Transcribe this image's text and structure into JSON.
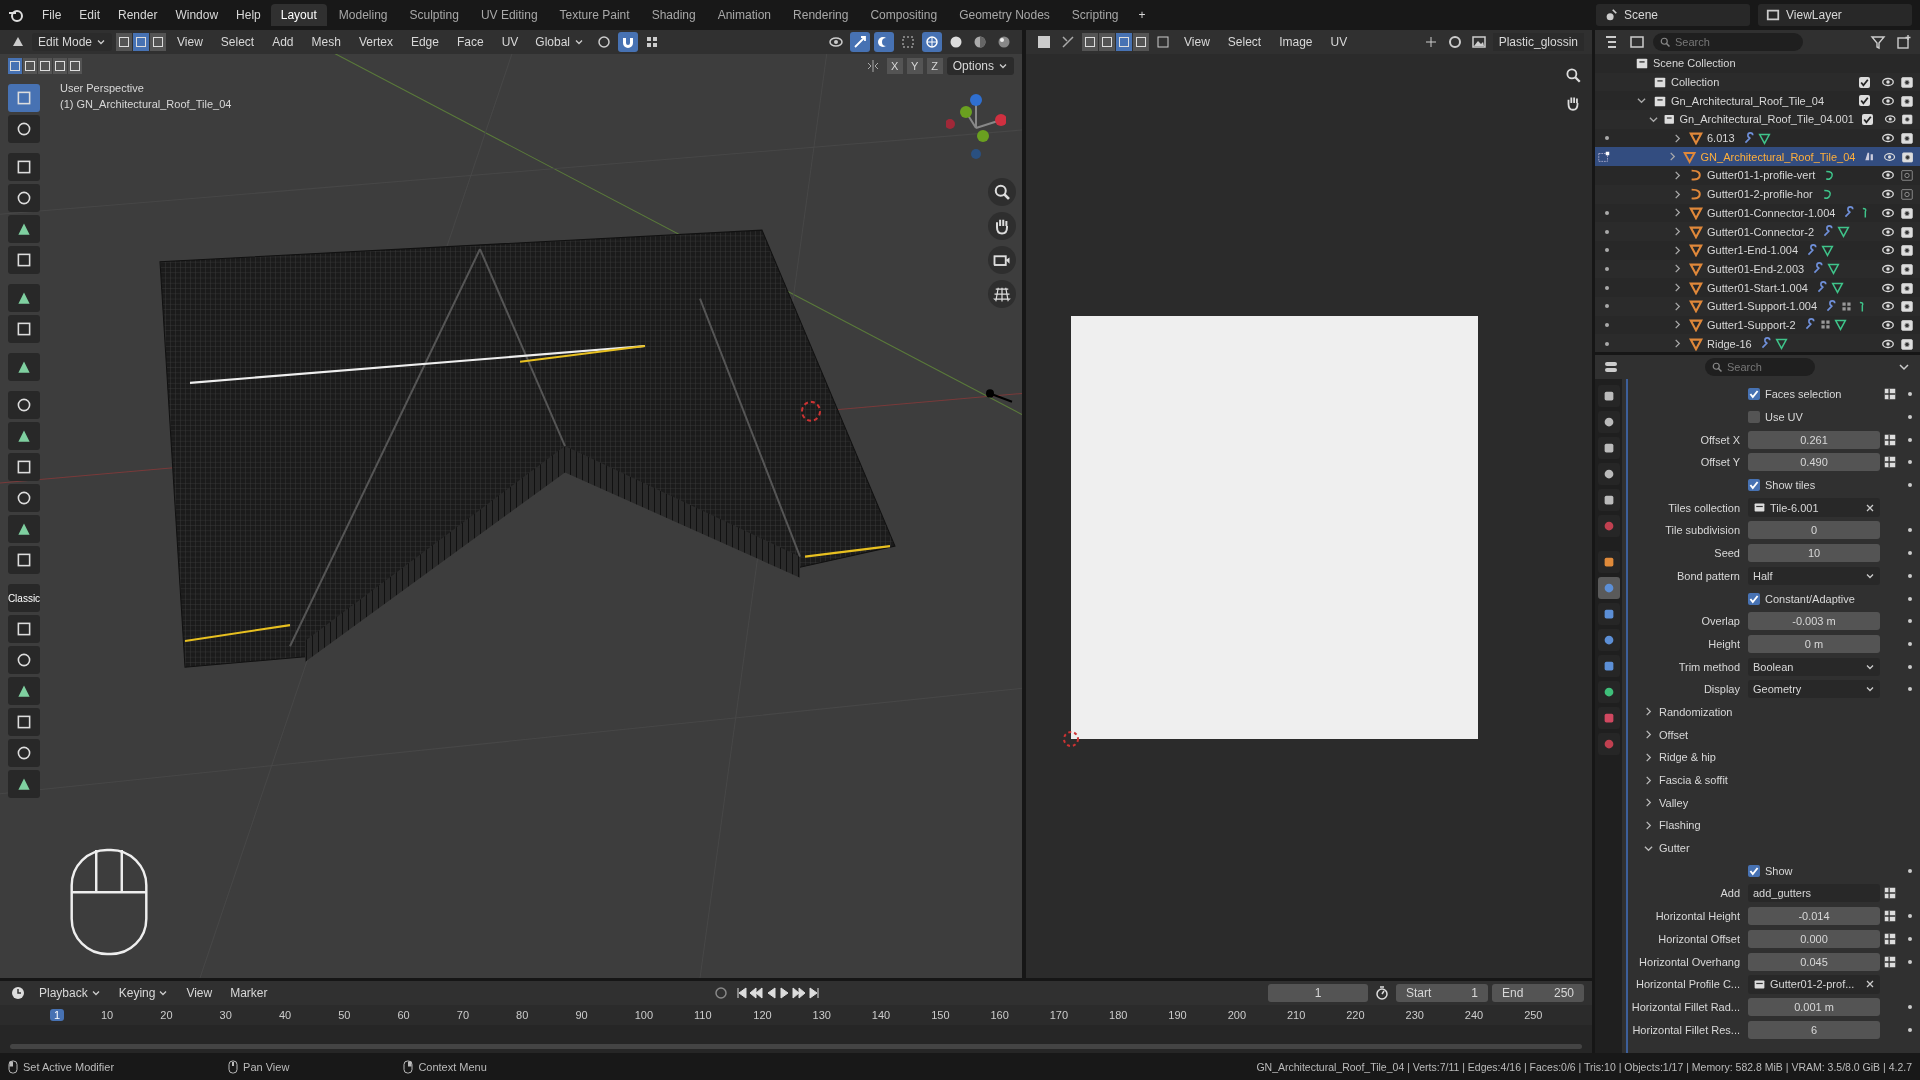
{
  "topbar": {
    "menus": [
      "File",
      "Edit",
      "Render",
      "Window",
      "Help"
    ],
    "workspaces": [
      {
        "label": "Layout",
        "selected": true
      },
      {
        "label": "Modeling",
        "selected": false
      },
      {
        "label": "Sculpting",
        "selected": false
      },
      {
        "label": "UV Editing",
        "selected": false
      },
      {
        "label": "Texture Paint",
        "selected": false
      },
      {
        "label": "Shading",
        "selected": false
      },
      {
        "label": "Animation",
        "selected": false
      },
      {
        "label": "Rendering",
        "selected": false
      },
      {
        "label": "Compositing",
        "selected": false
      },
      {
        "label": "Geometry Nodes",
        "selected": false
      },
      {
        "label": "Scripting",
        "selected": false
      }
    ],
    "add_tab": "+",
    "scene": "Scene",
    "view_layer": "ViewLayer"
  },
  "viewport": {
    "mode": "Edit Mode",
    "menus": [
      "View",
      "Select",
      "Add",
      "Mesh",
      "Vertex",
      "Edge",
      "Face",
      "UV"
    ],
    "orientation": "Global",
    "select_modes": [
      {
        "selected": false
      },
      {
        "selected": true
      },
      {
        "selected": false
      }
    ],
    "axes": [
      "X",
      "Y",
      "Z"
    ],
    "options": "Options",
    "perspective": "User Perspective",
    "object": "(1) GN_Architectural_Roof_Tile_04",
    "tool_label": "Classic"
  },
  "image_editor": {
    "menus": [
      "View",
      "Select",
      "Image",
      "UV"
    ],
    "image": "Plastic_glossin"
  },
  "outliner": {
    "search": {
      "placeholder": "Search"
    },
    "items": [
      {
        "name": "Scene Collection",
        "kind": "scene_collection",
        "children": [
          {
            "name": "Collection",
            "kind": "collection",
            "checked": true
          },
          {
            "name": "Gn_Architectural_Roof_Tile_04",
            "kind": "collection",
            "checked": true,
            "expanded": true,
            "children": [
              {
                "name": "Gn_Architectural_Roof_Tile_04.001",
                "kind": "collection",
                "checked": true,
                "expanded": true,
                "children": [
                  {
                    "name": "6.013",
                    "kind": "mesh",
                    "expanded": false,
                    "selected": false,
                    "edit_mode": false,
                    "renderable": true,
                    "extras": [
                      {
                        "kind": "wrench"
                      },
                      {
                        "kind": "mesh"
                      }
                    ]
                  },
                  {
                    "name": "GN_Architectural_Roof_Tile_04",
                    "kind": "mesh",
                    "expanded": false,
                    "selected": true,
                    "edit_mode": true,
                    "renderable": true,
                    "extras": [
                      {
                        "kind": "nodes"
                      }
                    ]
                  },
                  {
                    "name": "Gutter01-1-profile-vert",
                    "kind": "curve",
                    "expanded": false,
                    "selected": false,
                    "renderable": false,
                    "extras": [
                      {
                        "kind": "curve"
                      }
                    ]
                  },
                  {
                    "name": "Gutter01-2-profile-hor",
                    "kind": "curve",
                    "expanded": false,
                    "selected": false,
                    "renderable": false,
                    "extras": [
                      {
                        "kind": "curve"
                      }
                    ]
                  },
                  {
                    "name": "Gutter01-Connector-1.004",
                    "kind": "mesh",
                    "expanded": false,
                    "selected": false,
                    "edit_mode": false,
                    "renderable": true,
                    "extras": [
                      {
                        "kind": "wrench"
                      },
                      {
                        "kind": "hook"
                      }
                    ]
                  },
                  {
                    "name": "Gutter01-Connector-2",
                    "kind": "mesh",
                    "expanded": false,
                    "selected": false,
                    "edit_mode": false,
                    "renderable": true,
                    "extras": [
                      {
                        "kind": "wrench"
                      },
                      {
                        "kind": "mesh"
                      }
                    ]
                  },
                  {
                    "name": "Gutter1-End-1.004",
                    "kind": "mesh",
                    "expanded": false,
                    "selected": false,
                    "edit_mode": false,
                    "renderable": true,
                    "extras": [
                      {
                        "kind": "wrench"
                      },
                      {
                        "kind": "mesh"
                      }
                    ]
                  },
                  {
                    "name": "Gutter01-End-2.003",
                    "kind": "mesh",
                    "expanded": false,
                    "selected": false,
                    "edit_mode": false,
                    "renderable": true,
                    "extras": [
                      {
                        "kind": "wrench"
                      },
                      {
                        "kind": "mesh"
                      }
                    ]
                  },
                  {
                    "name": "Gutter01-Start-1.004",
                    "kind": "mesh",
                    "expanded": false,
                    "selected": false,
                    "edit_mode": false,
                    "renderable": true,
                    "extras": [
                      {
                        "kind": "wrench"
                      },
                      {
                        "kind": "mesh"
                      }
                    ]
                  },
                  {
                    "name": "Gutter1-Support-1.004",
                    "kind": "mesh",
                    "expanded": false,
                    "selected": false,
                    "edit_mode": false,
                    "renderable": true,
                    "extras": [
                      {
                        "kind": "wrench"
                      },
                      {
                        "kind": "grid"
                      },
                      {
                        "kind": "hook"
                      }
                    ]
                  },
                  {
                    "name": "Gutter1-Support-2",
                    "kind": "mesh",
                    "expanded": false,
                    "selected": false,
                    "edit_mode": false,
                    "renderable": true,
                    "extras": [
                      {
                        "kind": "wrench"
                      },
                      {
                        "kind": "grid"
                      },
                      {
                        "kind": "mesh"
                      }
                    ]
                  },
                  {
                    "name": "Ridge-16",
                    "kind": "mesh",
                    "expanded": false,
                    "selected": false,
                    "edit_mode": false,
                    "renderable": true,
                    "extras": [
                      {
                        "kind": "wrench"
                      },
                      {
                        "kind": "mesh"
                      }
                    ]
                  }
                ]
              }
            ]
          }
        ]
      }
    ]
  },
  "properties": {
    "search": {
      "placeholder": "Search"
    },
    "tabs": [
      {
        "kind": "tool",
        "selected": false
      },
      {
        "kind": "render",
        "selected": false
      },
      {
        "kind": "output",
        "selected": false
      },
      {
        "kind": "view_layer",
        "selected": false
      },
      {
        "kind": "scene",
        "selected": false
      },
      {
        "kind": "world",
        "selected": false
      },
      {
        "kind": "object",
        "selected": false
      },
      {
        "kind": "modifier",
        "selected": true
      },
      {
        "kind": "particles",
        "selected": false
      },
      {
        "kind": "physics",
        "selected": false
      },
      {
        "kind": "constraints",
        "selected": false
      },
      {
        "kind": "data",
        "selected": false
      },
      {
        "kind": "material",
        "selected": false
      },
      {
        "kind": "texture",
        "selected": false
      }
    ],
    "rows": [
      {
        "kind": "checkbox",
        "label": "Faces selection",
        "checked": true,
        "toggle": true,
        "dot": true
      },
      {
        "kind": "checkbox",
        "label": "Use UV",
        "checked": false,
        "toggle": false,
        "dot": true
      },
      {
        "kind": "number",
        "label": "Offset X",
        "value": "0.261",
        "toggle": true,
        "dot": true
      },
      {
        "kind": "number",
        "label": "Offset Y",
        "value": "0.490",
        "toggle": true,
        "dot": true
      },
      {
        "kind": "checkbox",
        "label": "Show tiles",
        "checked": true,
        "toggle": false,
        "dot": true
      },
      {
        "kind": "pointer",
        "label": "Tiles collection",
        "value": "Tile-6.001",
        "toggle": false,
        "dot": false
      },
      {
        "kind": "number",
        "label": "Tile subdivision",
        "value": "0",
        "toggle": false,
        "dot": true
      },
      {
        "kind": "number",
        "label": "Seed",
        "value": "10",
        "toggle": false,
        "dot": true
      },
      {
        "kind": "dropdown",
        "label": "Bond pattern",
        "value": "Half",
        "toggle": false,
        "dot": true
      },
      {
        "kind": "checkbox",
        "label": "Constant/Adaptive",
        "checked": true,
        "toggle": false,
        "dot": true
      },
      {
        "kind": "number",
        "label": "Overlap",
        "value": "-0.003 m",
        "toggle": false,
        "dot": true
      },
      {
        "kind": "number",
        "label": "Height",
        "value": "0 m",
        "toggle": false,
        "dot": true
      },
      {
        "kind": "dropdown",
        "label": "Trim method",
        "value": "Boolean",
        "toggle": false,
        "dot": true
      },
      {
        "kind": "dropdown",
        "label": "Display",
        "value": "Geometry",
        "toggle": false,
        "dot": true
      },
      {
        "kind": "panel",
        "label": "Randomization",
        "expanded": false
      },
      {
        "kind": "panel",
        "label": "Offset",
        "expanded": false
      },
      {
        "kind": "panel",
        "label": "Ridge & hip",
        "expanded": false
      },
      {
        "kind": "panel",
        "label": "Fascia & soffit",
        "expanded": false
      },
      {
        "kind": "panel",
        "label": "Valley",
        "expanded": false
      },
      {
        "kind": "panel",
        "label": "Flashing",
        "expanded": false
      },
      {
        "kind": "panel",
        "label": "Gutter",
        "expanded": true
      },
      {
        "kind": "checkbox",
        "label": "Show",
        "checked": true,
        "toggle": false,
        "dot": true
      },
      {
        "kind": "text",
        "label": "Add",
        "value": "add_gutters",
        "toggle": true,
        "dot": false
      },
      {
        "kind": "number",
        "label": "Horizontal Height",
        "value": "-0.014",
        "toggle": true,
        "dot": true
      },
      {
        "kind": "number",
        "label": "Horizontal Offset",
        "value": "0.000",
        "toggle": true,
        "dot": true
      },
      {
        "kind": "number",
        "label": "Horizontal Overhang",
        "value": "0.045",
        "toggle": true,
        "dot": true
      },
      {
        "kind": "pointer",
        "label": "Horizontal Profile C...",
        "value": "Gutter01-2-prof...",
        "toggle": false,
        "dot": false
      },
      {
        "kind": "number",
        "label": "Horizontal Fillet Rad...",
        "value": "0.001 m",
        "toggle": false,
        "dot": true
      },
      {
        "kind": "number",
        "label": "Horizontal Fillet Res...",
        "value": "6",
        "toggle": false,
        "dot": true
      }
    ]
  },
  "timeline": {
    "menus": [
      "Playback",
      "Keying",
      "View",
      "Marker"
    ],
    "current_frame": "1",
    "start_label": "Start",
    "start": "1",
    "end_label": "End",
    "end": "250",
    "ruler": [
      {
        "label": "1",
        "selected": true
      },
      {
        "label": "10",
        "selected": false
      },
      {
        "label": "20",
        "selected": false
      },
      {
        "label": "30",
        "selected": false
      },
      {
        "label": "40",
        "selected": false
      },
      {
        "label": "50",
        "selected": false
      },
      {
        "label": "60",
        "selected": false
      },
      {
        "label": "70",
        "selected": false
      },
      {
        "label": "80",
        "selected": false
      },
      {
        "label": "90",
        "selected": false
      },
      {
        "label": "100",
        "selected": false
      },
      {
        "label": "110",
        "selected": false
      },
      {
        "label": "120",
        "selected": false
      },
      {
        "label": "130",
        "selected": false
      },
      {
        "label": "140",
        "selected": false
      },
      {
        "label": "150",
        "selected": false
      },
      {
        "label": "160",
        "selected": false
      },
      {
        "label": "170",
        "selected": false
      },
      {
        "label": "180",
        "selected": false
      },
      {
        "label": "190",
        "selected": false
      },
      {
        "label": "200",
        "selected": false
      },
      {
        "label": "210",
        "selected": false
      },
      {
        "label": "220",
        "selected": false
      },
      {
        "label": "230",
        "selected": false
      },
      {
        "label": "240",
        "selected": false
      },
      {
        "label": "250",
        "selected": false
      }
    ]
  },
  "status_bar": {
    "hints": [
      {
        "kind": "left_mouse",
        "label": "Set Active Modifier"
      },
      {
        "kind": "middle_mouse",
        "label": "Pan View"
      },
      {
        "kind": "right_mouse",
        "label": "Context Menu"
      }
    ],
    "stats": "GN_Architectural_Roof_Tile_04 | Verts:7/11 | Edges:4/16 | Faces:0/6 | Tris:10 | Objects:1/17 | Memory: 582.8 MiB | VRAM: 3.5/8.0 GiB | 4.2.7"
  }
}
